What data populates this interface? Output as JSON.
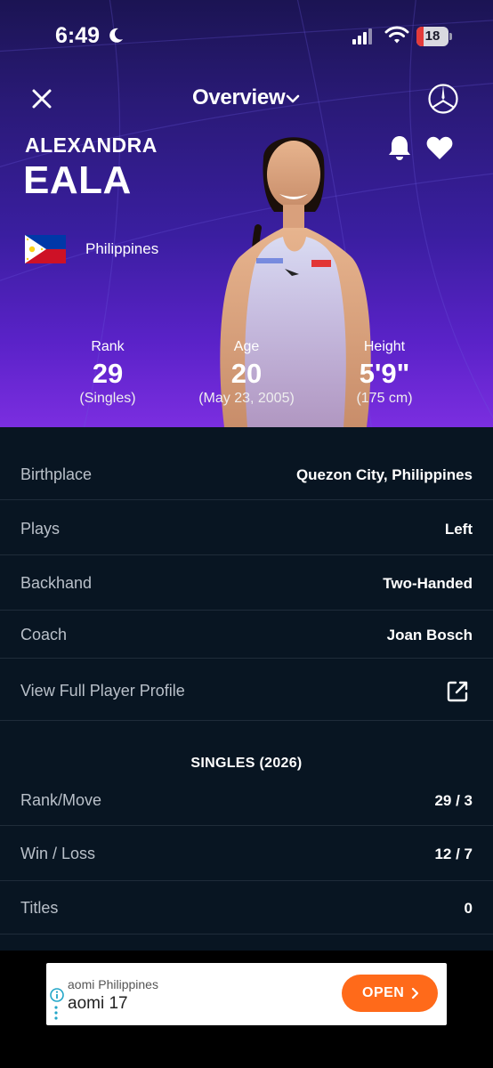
{
  "status_bar": {
    "time": "6:49",
    "battery_level": "18"
  },
  "nav": {
    "title": "Overview"
  },
  "player": {
    "first_name": "ALEXANDRA",
    "last_name": "EALA",
    "country": "Philippines"
  },
  "stats": {
    "rank": {
      "label": "Rank",
      "value": "29",
      "sub": "(Singles)"
    },
    "age": {
      "label": "Age",
      "value": "20",
      "sub": "(May 23, 2005)"
    },
    "height": {
      "label": "Height",
      "value": "5'9\"",
      "sub": "(175 cm)"
    }
  },
  "details": [
    {
      "label": "Birthplace",
      "value": "Quezon City, Philippines"
    },
    {
      "label": "Plays",
      "value": "Left"
    },
    {
      "label": "Backhand",
      "value": "Two-Handed"
    },
    {
      "label": "Coach",
      "value": "Joan Bosch"
    }
  ],
  "profile_link": {
    "label": "View Full Player Profile"
  },
  "singles": {
    "title": "SINGLES (2026)",
    "rows": [
      {
        "label": "Rank/Move",
        "value": "29 / 3"
      },
      {
        "label": "Win / Loss",
        "value": "12 / 7"
      },
      {
        "label": "Titles",
        "value": "0"
      }
    ]
  },
  "ad": {
    "advertiser": "aomi Philippines",
    "title": "aomi 17",
    "button": "OPEN"
  },
  "colors": {
    "hero_top": "#1b1453",
    "hero_bottom": "#7b2ee0",
    "content_bg": "#081522",
    "ad_button": "#ff6a1a"
  }
}
